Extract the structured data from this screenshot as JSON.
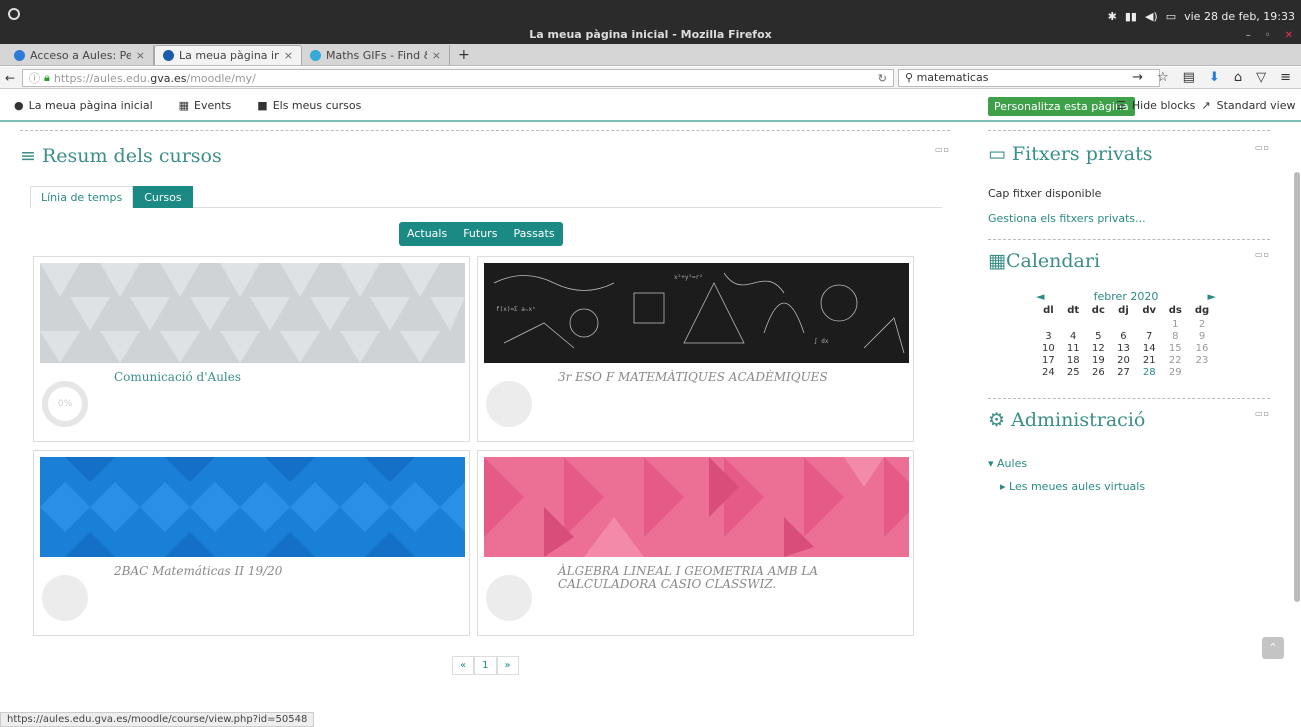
{
  "system": {
    "window_title": "La meua pàgina inicial - Mozilla Firefox",
    "clock": "vie 28 de feb, 19:33"
  },
  "tabs": [
    {
      "label": "Acceso a Aules: Perso",
      "icon_color": "#2b7bd8"
    },
    {
      "label": "La meua pàgina inicial",
      "icon_color": "#1b5cab"
    },
    {
      "label": "Maths GIFs - Find & Sl",
      "icon_color": "#35a9d9"
    }
  ],
  "nav": {
    "url_prefix": "https://aules.edu.",
    "url_domain": "gva.es",
    "url_path": "/moodle/my/",
    "search_value": "matematicas"
  },
  "moodle_bar": {
    "home": "La meua pàgina inicial",
    "events": "Events",
    "courses": "Els meus cursos",
    "personalize": "Personalitza esta pàgina",
    "hide_blocks": "Hide blocks",
    "standard_view": "Standard view"
  },
  "overview": {
    "title": "Resum dels cursos",
    "tabs": [
      "Línia de temps",
      "Cursos"
    ],
    "filters": [
      "Actuals",
      "Futurs",
      "Passats"
    ],
    "courses": [
      {
        "name": "Comunicació d'Aules",
        "progress": "0%",
        "pattern": "gray"
      },
      {
        "name": "3r ESO F MATEMÀTIQUES ACADÈMIQUES",
        "pattern": "chalk"
      },
      {
        "name": "2BAC Matemáticas II 19/20",
        "pattern": "blue"
      },
      {
        "name": "ÀLGEBRA LINEAL I GEOMETRIA AMB LA CALCULADORA CASIO CLASSWIZ.",
        "pattern": "pink"
      }
    ],
    "pager": [
      "«",
      "1",
      "»"
    ]
  },
  "private_files": {
    "title": "Fitxers privats",
    "empty": "Cap fitxer disponible",
    "manage": "Gestiona els fitxers privats..."
  },
  "calendar": {
    "title": "Calendari",
    "month": "febrer 2020",
    "weekdays": [
      "dl",
      "dt",
      "dc",
      "dj",
      "dv",
      "ds",
      "dg"
    ],
    "weeks": [
      [
        "",
        "",
        "",
        "",
        "",
        "1",
        "2"
      ],
      [
        "3",
        "4",
        "5",
        "6",
        "7",
        "8",
        "9"
      ],
      [
        "10",
        "11",
        "12",
        "13",
        "14",
        "15",
        "16"
      ],
      [
        "17",
        "18",
        "19",
        "20",
        "21",
        "22",
        "23"
      ],
      [
        "24",
        "25",
        "26",
        "27",
        "28",
        "29",
        ""
      ]
    ],
    "today": "28"
  },
  "admin": {
    "title": "Administració",
    "root": "Aules",
    "child": "Les meues aules virtuals"
  },
  "statusbar": "https://aules.edu.gva.es/moodle/course/view.php?id=50548"
}
